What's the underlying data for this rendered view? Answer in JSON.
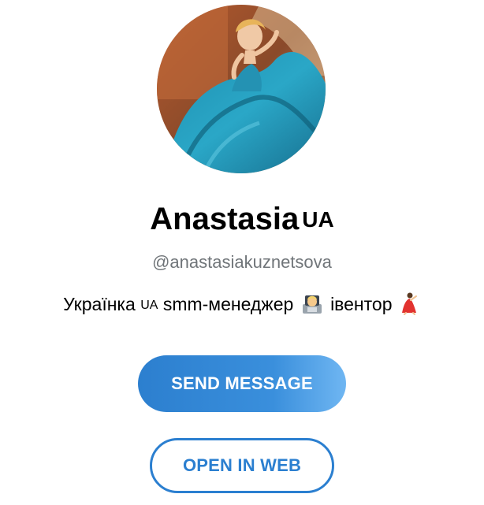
{
  "profile": {
    "name": "Anastasia",
    "name_flag": "UA",
    "handle": "@anastasiakuznetsova",
    "bio": {
      "part1": "Українка",
      "flag": "UA",
      "part2": "smm-менеджер",
      "emoji1": "technologist-emoji",
      "part3": "івентор",
      "emoji2": "dancer-emoji"
    }
  },
  "actions": {
    "send_message": "SEND MESSAGE",
    "open_in_web": "OPEN IN WEB"
  },
  "colors": {
    "accent": "#2b7fd0",
    "handle_gray": "#707579"
  }
}
